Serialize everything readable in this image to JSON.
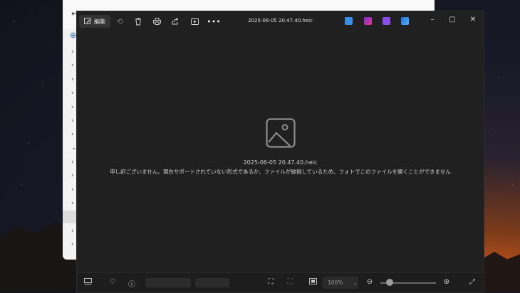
{
  "toolbar": {
    "edit_label": "編集"
  },
  "window": {
    "title": "2025-06-05 20.47.40.heic"
  },
  "taskbar_apps": [
    {
      "name": "clipchamp-icon",
      "color": "#3a8ee6"
    },
    {
      "name": "designer-icon",
      "color": "#c23ad6"
    },
    {
      "name": "clipchamp-purple-icon",
      "color": "#8a4de8"
    },
    {
      "name": "onedrive-icon",
      "color": "#3a8ee6"
    }
  ],
  "viewer": {
    "file_name": "2025-06-05 20.47.40.heic",
    "error_message": "申し訳ございません。現在サポートされていない形式であるか、ファイルが破損しているため、フォトでこのファイルを開くことができません"
  },
  "bottom": {
    "zoom": "100%"
  }
}
